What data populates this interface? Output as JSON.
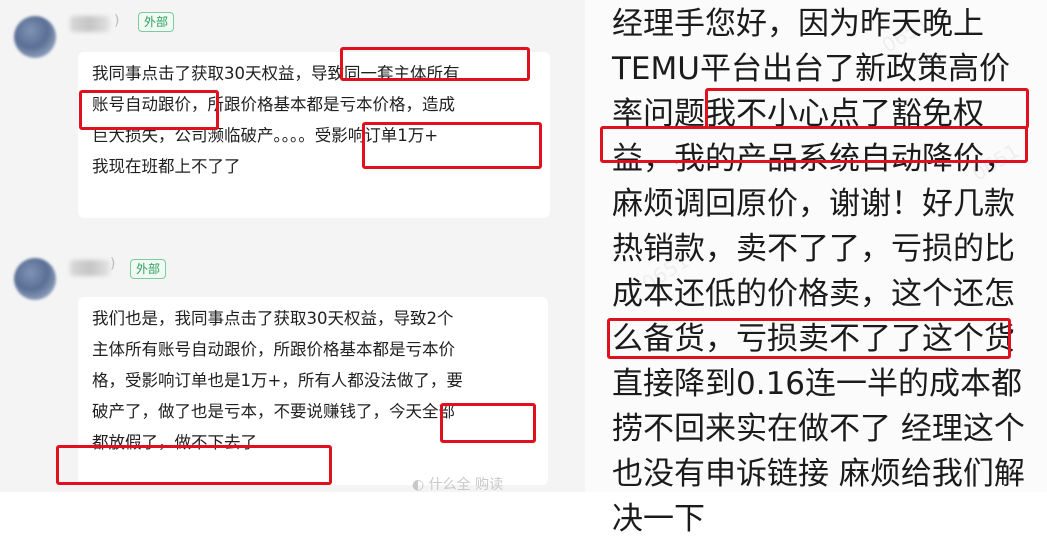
{
  "left_chat": {
    "messages": [
      {
        "paren": ")",
        "tag": "外部",
        "lines": [
          "我同事点击了获取30天权益，导致同一套主体所有",
          "账号自动跟价，所跟价格基本都是亏本价格，造成",
          "巨大损失，公司濒临破产。。。。受影响订单1万+",
          "我现在班都上不了了"
        ]
      },
      {
        "paren": ")",
        "tag": "外部",
        "lines": [
          "我们也是，我同事点击了获取30天权益，导致2个",
          "主体所有账号自动跟价，所跟价格基本都是亏本价",
          "格，受影响订单也是1万+，所有人都没法做了，要",
          "破产了，做了也是亏本，不要说赚钱了，今天全部",
          "都放假了，做不下去了"
        ]
      }
    ],
    "footer_fragment": "◐  什么全       购读"
  },
  "right_note": {
    "lines": [
      "经理手您好，因为昨天晚上",
      "TEMU平台出台了新政策高价",
      "率问题我不小心点了豁免权",
      "益，我的产品系统自动降价，",
      "麻烦调回原价，谢谢！好几款",
      "热销款，卖不了了，亏损的比",
      "成本还低的价格卖，这个还怎",
      "么备货，亏损卖不了了这个货",
      "直接降到0.16连一半的成本都",
      "捞不回来实在做不了 经理这个",
      "也没有申诉链接 麻烦给我们解",
      "决一下"
    ],
    "watermark": "0651"
  },
  "colors": {
    "highlight": "#e0101e",
    "tag_green": "#2e9e5f",
    "chat_bg": "#f4f4f4"
  }
}
